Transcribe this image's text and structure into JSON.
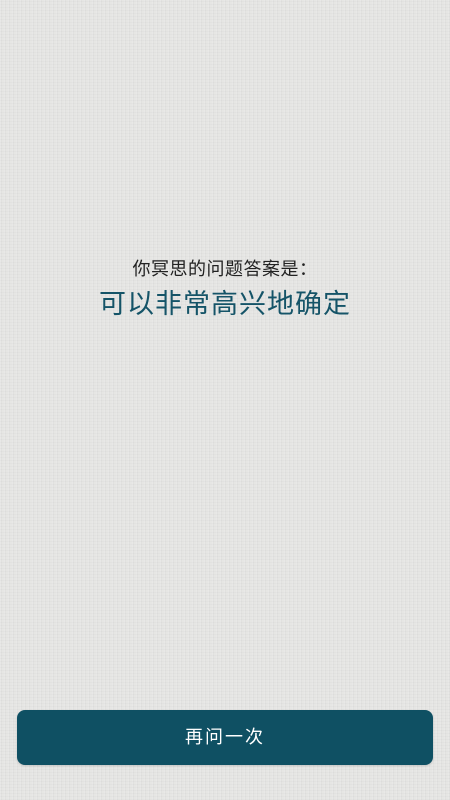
{
  "main": {
    "prompt": "你冥思的问题答案是：",
    "answer": "可以非常高兴地确定"
  },
  "footer": {
    "ask_again_label": "再问一次"
  },
  "colors": {
    "background": "#e6e6e4",
    "answer_text": "#155468",
    "button": "#0f5063"
  }
}
